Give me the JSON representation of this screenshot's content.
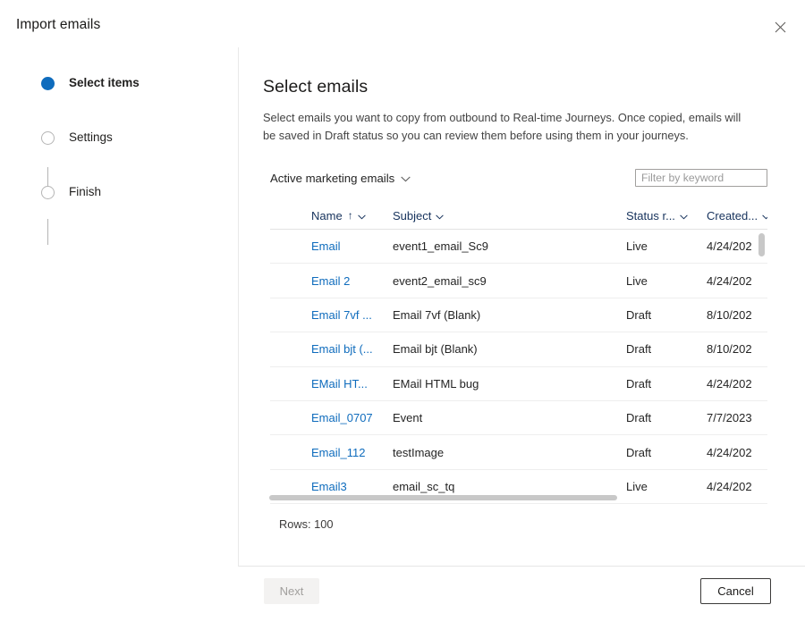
{
  "dialog": {
    "title": "Import emails",
    "close_icon": "close-icon"
  },
  "stepper": {
    "steps": [
      {
        "label": "Select items",
        "state": "active"
      },
      {
        "label": "Settings",
        "state": "idle"
      },
      {
        "label": "Finish",
        "state": "idle"
      }
    ]
  },
  "pane": {
    "title": "Select emails",
    "description": "Select emails you want to copy from outbound to Real-time Journeys. Once copied, emails will be saved in Draft status so you can review them before using them in your journeys."
  },
  "toolbar": {
    "view_label": "Active marketing emails",
    "view_chevron_icon": "chevron-down-icon",
    "filter_placeholder": "Filter by keyword",
    "filter_value": ""
  },
  "grid": {
    "columns": [
      {
        "key": "check",
        "label": "",
        "sort": "",
        "chevron": false
      },
      {
        "key": "name",
        "label": "Name",
        "sort": "↑",
        "chevron": true
      },
      {
        "key": "subject",
        "label": "Subject",
        "sort": "",
        "chevron": true
      },
      {
        "key": "status",
        "label": "Status r...",
        "sort": "",
        "chevron": true
      },
      {
        "key": "created",
        "label": "Created...",
        "sort": "",
        "chevron": true
      }
    ],
    "rows": [
      {
        "name": "Email",
        "subject": "event1_email_Sc9",
        "status": "Live",
        "created": "4/24/202"
      },
      {
        "name": "Email 2",
        "subject": "event2_email_sc9",
        "status": "Live",
        "created": "4/24/202"
      },
      {
        "name": "Email 7vf ...",
        "subject": "Email 7vf (Blank)",
        "status": "Draft",
        "created": "8/10/202"
      },
      {
        "name": "Email bjt (...",
        "subject": "Email bjt (Blank)",
        "status": "Draft",
        "created": "8/10/202"
      },
      {
        "name": "EMail HT...",
        "subject": "EMail HTML bug",
        "status": "Draft",
        "created": "4/24/202"
      },
      {
        "name": "Email_0707",
        "subject": "Event",
        "status": "Draft",
        "created": "7/7/2023"
      },
      {
        "name": "Email_112",
        "subject": "testImage",
        "status": "Draft",
        "created": "4/24/202"
      },
      {
        "name": "Email3",
        "subject": "email_sc_tq",
        "status": "Live",
        "created": "4/24/202"
      }
    ],
    "rows_count_label": "Rows: 100"
  },
  "footer": {
    "next_label": "Next",
    "cancel_label": "Cancel"
  },
  "colors": {
    "accent": "#0f6cbd",
    "link": "#0f6cbd",
    "header_text": "#16325c",
    "divider": "#e9e9e9",
    "scrollbar": "#c8c8c8"
  }
}
